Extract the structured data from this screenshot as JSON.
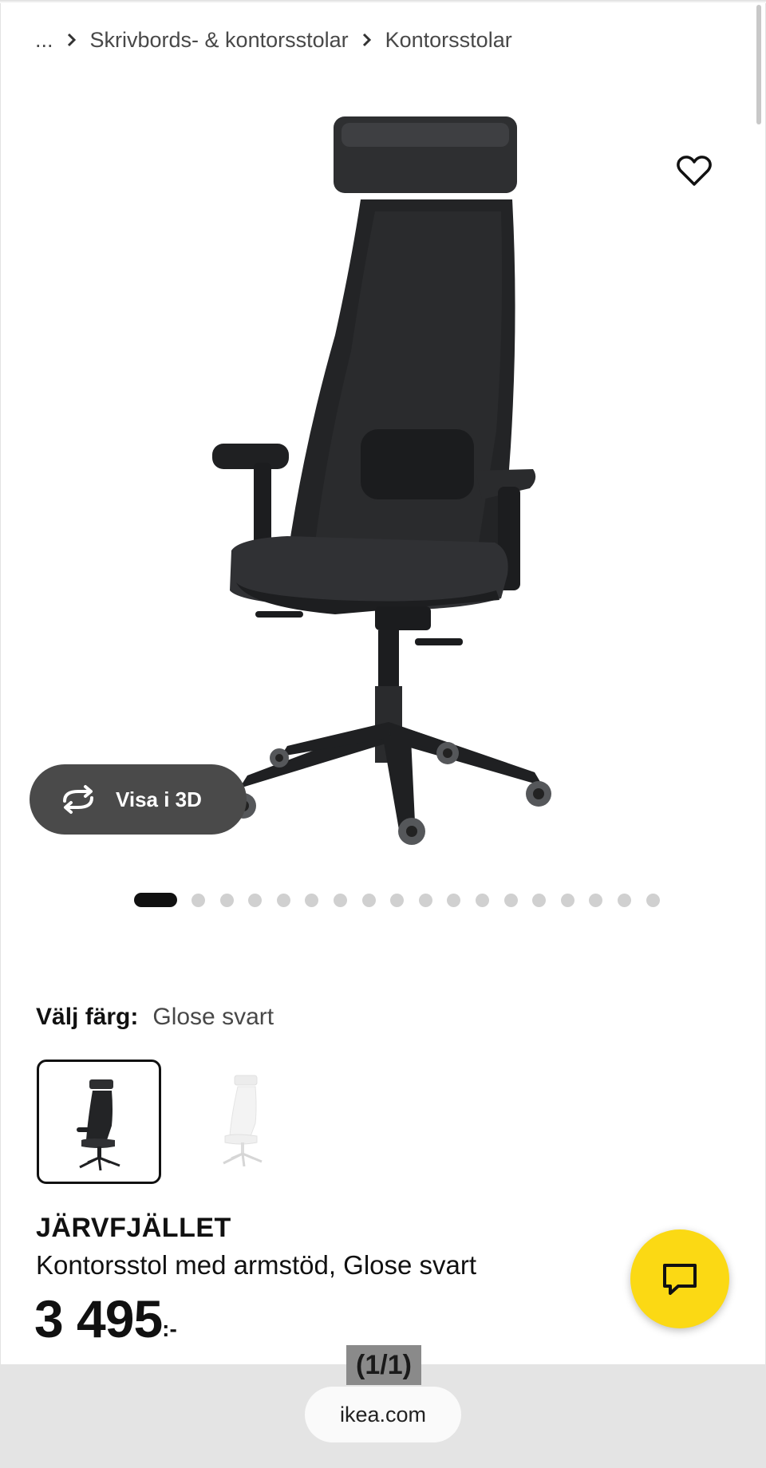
{
  "breadcrumb": {
    "items": [
      "...",
      "Skrivbords- & kontorsstolar",
      "Kontorsstolar"
    ]
  },
  "gallery": {
    "view_3d_label": "Visa i 3D",
    "dot_count": 18,
    "active_index": 0
  },
  "color_select": {
    "label": "Välj färg:",
    "value": "Glose svart",
    "options": [
      "black",
      "white"
    ],
    "selected_index": 0
  },
  "product": {
    "name": "JÄRVFJÄLLET",
    "description": "Kontorsstol med armstöd, Glose svart",
    "price": "3 495",
    "price_suffix": ":-"
  },
  "browser": {
    "tab_counter": "(1/1)",
    "url": "ikea.com"
  },
  "colors": {
    "accent_yellow": "#fbd914",
    "pill_dark": "#4a4a4a",
    "text_dark": "#111111",
    "text_muted": "#484848"
  },
  "icons": {
    "favorite": "heart-outline-icon",
    "view_3d": "rotate-arrows-icon",
    "chat": "chat-bubble-icon",
    "breadcrumb_separator": "chevron-right-icon"
  }
}
